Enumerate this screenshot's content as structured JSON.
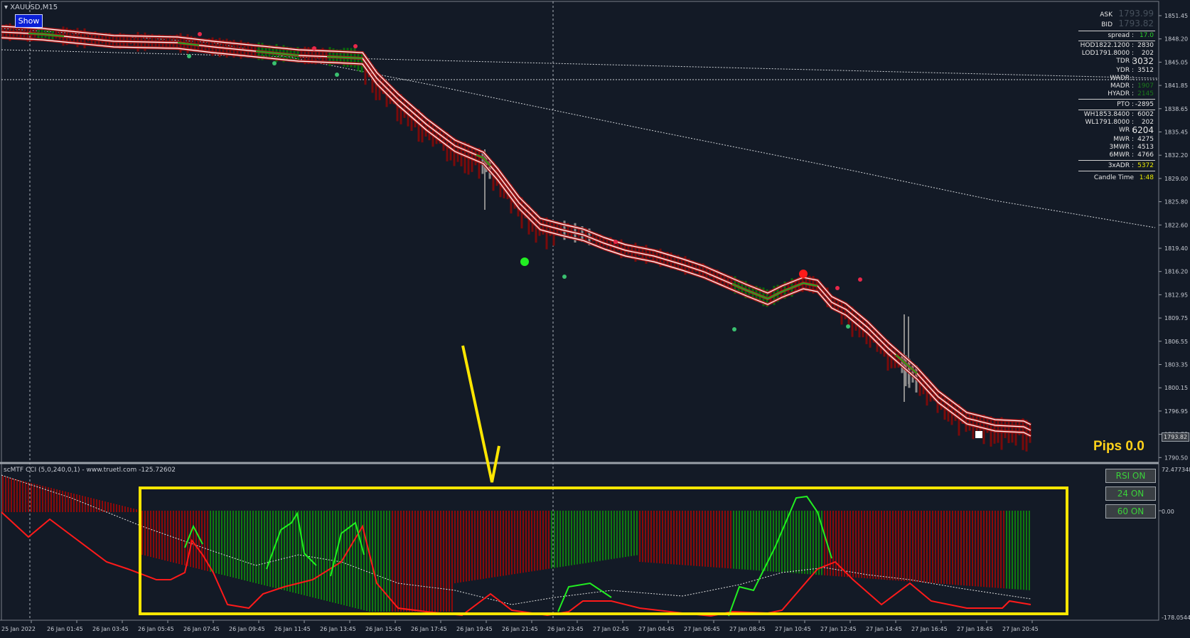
{
  "header": {
    "symbol_title": "XAUUSD,M15",
    "show_button": "Show"
  },
  "info_panel": {
    "ask_label": "ASK",
    "ask_value": "1793.99",
    "bid_label": "BID",
    "bid_value": "1793.82",
    "spread_label": "spread :",
    "spread_value": "17.0",
    "hod_label": "HOD1822.1200 :",
    "hod_value": "2830",
    "lod_label": "LOD1791.8000 :",
    "lod_value": "202",
    "tdr_label": "TDR :",
    "tdr_value": "3032",
    "ydr_label": "YDR :",
    "ydr_value": "3512",
    "wadr_label": "WADR :",
    "wadr_value": "",
    "madr_label": "MADR :",
    "madr_value": "1907",
    "hyadr_label": "HYADR :",
    "hyadr_value": "2145",
    "pto_label": "PTO :",
    "pto_value": "-2895",
    "wh_label": "WH1853.8400 :",
    "wh_value": "6002",
    "wl_label": "WL1791.8000 :",
    "wl_value": "202",
    "wr_label": "WR :",
    "wr_value": "6204",
    "mwr_label": "MWR :",
    "mwr_value": "4275",
    "mwr3_label": "3MWR :",
    "mwr3_value": "4513",
    "mwr6_label": "6MWR :",
    "mwr6_value": "4766",
    "adr3_label": "3xADR :",
    "adr3_value": "5372",
    "candle_label": "Candle Time",
    "candle_value": "1:48"
  },
  "pips_label": "Pips 0.0",
  "current_price_tag": "1793.82",
  "price_axis": [
    "1851.45",
    "1848.20",
    "1845.05",
    "1841.85",
    "1838.65",
    "1835.45",
    "1832.20",
    "1829.00",
    "1825.80",
    "1822.60",
    "1819.40",
    "1816.20",
    "1812.95",
    "1809.75",
    "1806.55",
    "1803.35",
    "1800.15",
    "1796.95",
    "1793.75",
    "1790.50"
  ],
  "indicator": {
    "title": "scMTF CCI (5,0,240,0,1) - www.truetl.com -125.72602",
    "axis_top": "72.477348",
    "axis_zero": "0.00",
    "axis_bottom": "-178.0544",
    "buttons": [
      "RSI ON",
      "24 ON",
      "60 ON"
    ]
  },
  "time_axis": [
    "25 Jan 2022",
    "26 Jan 01:45",
    "26 Jan 03:45",
    "26 Jan 05:45",
    "26 Jan 07:45",
    "26 Jan 09:45",
    "26 Jan 11:45",
    "26 Jan 13:45",
    "26 Jan 15:45",
    "26 Jan 17:45",
    "26 Jan 19:45",
    "26 Jan 21:45",
    "26 Jan 23:45",
    "27 Jan 02:45",
    "27 Jan 04:45",
    "27 Jan 06:45",
    "27 Jan 08:45",
    "27 Jan 10:45",
    "27 Jan 12:45",
    "27 Jan 14:45",
    "27 Jan 16:45",
    "27 Jan 18:45",
    "27 Jan 20:45"
  ],
  "colors": {
    "background": "#131a26",
    "bear_candle": "#8b0000",
    "bull_candle": "#006400",
    "neutral_candle": "#8c8c8c",
    "band_outline": "#b01e1e",
    "band_fill": "#ffffff",
    "highlight_box": "#ffe600",
    "cci_line_red": "#ff1a1a",
    "cci_line_green": "#22ee22",
    "pips_text": "#ffd21a"
  }
}
